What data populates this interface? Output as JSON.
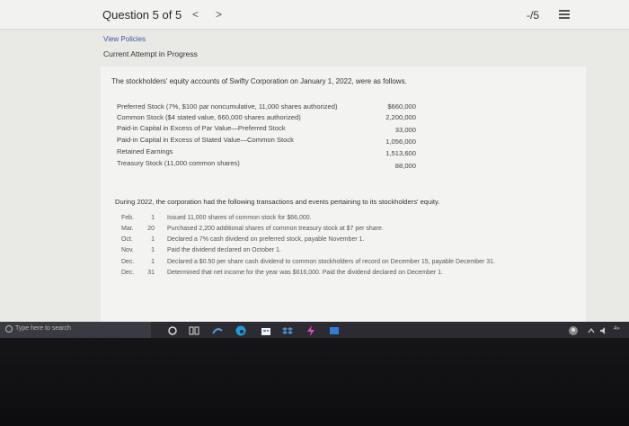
{
  "header": {
    "question_label": "Question 5 of 5",
    "prev_arrow": "<",
    "next_arrow": ">",
    "score": "-/5"
  },
  "links": {
    "view_policies": "View Policies"
  },
  "attempt_status": "Current Attempt in Progress",
  "problem": {
    "intro": "The stockholders' equity accounts of Swifty Corporation on January 1, 2022, were as follows.",
    "equity_accounts": [
      {
        "label": "Preferred Stock (7%, $100 par noncumulative, 11,000 shares authorized)",
        "amount": "$660,000"
      },
      {
        "label": "Common Stock ($4 stated value, 660,000 shares authorized)",
        "amount": "2,200,000"
      },
      {
        "label": "Paid-in Capital in Excess of Par Value—Preferred Stock",
        "amount": "33,000"
      },
      {
        "label": "Paid-in Capital in Excess of Stated Value—Common Stock",
        "amount": "1,056,000"
      },
      {
        "label": "Retained Earnings",
        "amount": "1,513,600"
      },
      {
        "label": "Treasury Stock (11,000 common shares)",
        "amount": "88,000"
      }
    ],
    "during": "During 2022, the corporation had the following transactions and events pertaining to its stockholders' equity.",
    "transactions": [
      {
        "month": "Feb.",
        "day": "1",
        "desc": "Issued 11,000 shares of common stock for $66,000."
      },
      {
        "month": "Mar.",
        "day": "20",
        "desc": "Purchased 2,200 additional shares of common treasury stock at $7 per share."
      },
      {
        "month": "Oct.",
        "day": "1",
        "desc": "Declared a 7% cash dividend on preferred stock, payable November 1."
      },
      {
        "month": "Nov.",
        "day": "1",
        "desc": "Paid the dividend declared on October 1."
      },
      {
        "month": "Dec.",
        "day": "1",
        "desc": "Declared a $0.50 per share cash dividend to common stockholders of record on December 15, payable December 31."
      },
      {
        "month": "Dec.",
        "day": "31",
        "desc": "Determined that net income for the year was $616,000. Paid the dividend declared on December 1."
      }
    ]
  },
  "taskbar": {
    "search_placeholder": "Type here to search",
    "tray_text": "4»"
  },
  "colors": {
    "accent_link": "#3a5a9a",
    "taskbar": "#2b2b31",
    "edge_icon": "#1e9bd7",
    "store_icon": "#4a8fd4"
  }
}
